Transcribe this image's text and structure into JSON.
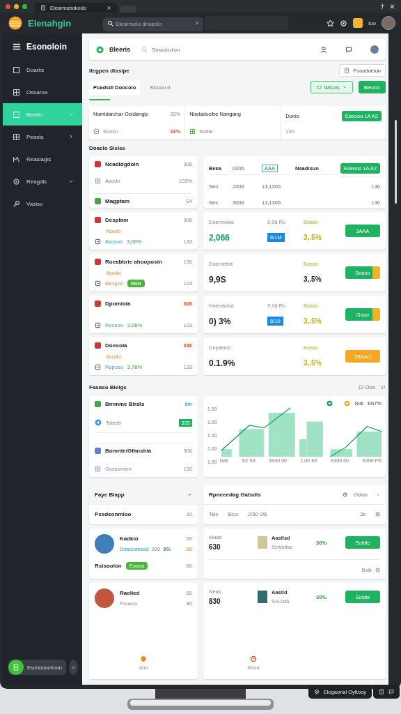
{
  "window": {
    "tab_title": "Elearmsbokodo"
  },
  "topbar": {
    "brand": "Elenahgin",
    "search_placeholder": "Elearmolo dhosolo",
    "user_label": "Ioo"
  },
  "sidebar": {
    "title": "Esonoloin",
    "items": [
      {
        "label": "Doarks",
        "selected": false,
        "has_children": false
      },
      {
        "label": "Ossaroa",
        "selected": false,
        "has_children": false
      },
      {
        "label": "Beario",
        "selected": true,
        "has_children": true,
        "expanded": true
      },
      {
        "label": "Peasia",
        "selected": false,
        "has_children": true,
        "expanded": false
      },
      {
        "label": "Reaslagis",
        "selected": false,
        "has_children": false
      },
      {
        "label": "Reagdis",
        "selected": false,
        "has_children": true,
        "expanded": true
      },
      {
        "label": "Vasiso",
        "selected": false,
        "has_children": false
      }
    ],
    "footer_button": "Esonoouchoon"
  },
  "header_card": {
    "title": "Bleeris",
    "search_placeholder": "Smodoolon"
  },
  "page": {
    "title": "Ilegpen dissipe",
    "action": "Fooodoeion"
  },
  "tabs": [
    {
      "label": "Poadsdi Doocolo",
      "selected": true
    },
    {
      "label": "Slcoou 0",
      "selected": false
    }
  ],
  "toolbar_buttons": [
    {
      "label": "Wisois",
      "kind": "outline"
    },
    {
      "label": "Bleooo",
      "kind": "solid"
    }
  ],
  "summary": {
    "columns": [
      {
        "title": "Namidarchar Ooidangip",
        "value": "33%",
        "sub": "Sooso",
        "sub_value": "33%"
      },
      {
        "title": "Nisdadocibe Nangang",
        "sub": "Sobie"
      },
      {
        "title": "Donio",
        "sub": "190"
      }
    ],
    "button": "Eseooo 1A A2"
  },
  "section1": {
    "title": "Doaclo Sielee"
  },
  "left_cards": [
    {
      "rows": [
        {
          "kind": "title",
          "text": "Ncadidgdoin",
          "value": "306",
          "alert": false
        },
        {
          "kind": "plain",
          "text": "Asodo",
          "value": "103%"
        },
        {
          "kind": "title",
          "text": "Magptam",
          "value": "04",
          "alert": false
        }
      ]
    },
    {
      "rows": [
        {
          "kind": "title",
          "text": "Desplam",
          "value": "306",
          "alert": false
        },
        {
          "kind": "note",
          "text": "Asodo"
        },
        {
          "kind": "stat",
          "text": "Asosoo",
          "pct": "3,06%",
          "value": "133"
        }
      ]
    },
    {
      "rows": [
        {
          "kind": "title",
          "text": "Roeabbrie ahooposin",
          "value": "106",
          "alert": false
        },
        {
          "kind": "note",
          "text": "Asodo"
        },
        {
          "kind": "tagged",
          "text": "Beogoe",
          "tag": "BBB",
          "value": "103"
        }
      ]
    },
    {
      "rows": [
        {
          "kind": "title",
          "text": "Dpomiola",
          "value": "306",
          "alert": true
        },
        {
          "kind": "stat",
          "text": "Roosoo",
          "pct": "3,06%",
          "value": "103"
        }
      ]
    },
    {
      "rows": [
        {
          "kind": "title",
          "text": "Doeoola",
          "value": "336",
          "alert": true
        },
        {
          "kind": "note",
          "text": "Asodo"
        },
        {
          "kind": "stat",
          "text": "Roposo",
          "pct": "3,76%",
          "value": "133"
        }
      ]
    }
  ],
  "right_cards": [
    {
      "kind": "table",
      "header": [
        "Besa",
        "0006",
        "AAA",
        "Nsadisun"
      ],
      "button": "Eseooo 1A A2",
      "rows": [
        [
          "Seo",
          "2006",
          "13,1306",
          "130"
        ],
        [
          "Ses",
          "3006",
          "13,1306",
          "130"
        ]
      ]
    },
    {
      "kind": "metric",
      "label": "Doennolee",
      "value": "2,066",
      "value_positive": true,
      "mid": "8,98 Ro",
      "badge": "8/1M",
      "change_label": "Bosso",
      "change": "3,.5%",
      "change_highlight": true,
      "button": "3AAA",
      "button_warning": false,
      "button_accent": false
    },
    {
      "kind": "metric",
      "label": "Doeroeilot",
      "value": "9,9S",
      "value_positive": false,
      "change_label": "Bosso",
      "change": "3,.5%",
      "change_highlight": false,
      "button": "Bosso",
      "button_warning": false,
      "button_accent": true
    },
    {
      "kind": "metric",
      "label": "Hoendeilot",
      "value": "0) 3%",
      "value_positive": false,
      "mid": "9,96 Ro",
      "badge": "8/10",
      "change_label": "Bosso",
      "change": "3,.5%",
      "change_highlight": true,
      "button": "Gooo",
      "button_warning": false,
      "button_accent": true
    },
    {
      "kind": "metric",
      "label": "Depalnist",
      "value": "0.1.9%",
      "value_positive": false,
      "change_label": "Bosso",
      "change": "3,.5%",
      "change_highlight": true,
      "button": "33AAO",
      "button_warning": true,
      "button_accent": false
    }
  ],
  "section2": {
    "title": "Fasaso Bielgs",
    "action": "Ooo"
  },
  "list_card": {
    "rows": [
      {
        "kind": "title",
        "text": "Bmmme Blrdis",
        "value": "8m"
      },
      {
        "kind": "badge",
        "text": "Taleeb",
        "value": "333"
      },
      {
        "kind": "title",
        "text": "Bomnte/Gfanshia",
        "value": "306"
      },
      {
        "kind": "plain",
        "text": "Gossomien",
        "value": "100"
      }
    ]
  },
  "chart_panel": {
    "y_labels": [
      "1.00",
      "1.00",
      "1.00",
      "1.00",
      "1.00"
    ],
    "x_labels": [
      "Nas",
      "S3 S3",
      "3S00 00",
      "1.00 S0",
      "S300 00",
      "S300 PS"
    ],
    "legend": [
      "Sldi",
      "Eb7%"
    ]
  },
  "people_panel": {
    "title": "Faye Biapp",
    "subtitle": "Pssdsonmioo",
    "subtitle_value": "10",
    "people": [
      {
        "name": "Kadkio",
        "detail": "Dossoanesd",
        "amount": "300",
        "change": "3%",
        "value1": "00",
        "value2": "80",
        "tag_label": "Rsisoolon",
        "tag": "Eoooo",
        "tag_value": "80"
      },
      {
        "name": "Raelied",
        "detail": "Poosoo",
        "value1": "80",
        "value2": "80"
      }
    ],
    "footer": "ano"
  },
  "report_panel": {
    "title": "Rpneeedag Gatsdis",
    "action": "Ooloo",
    "columns": [
      "Tsio",
      "Bioo",
      "2/30 0/6"
    ],
    "header_value": "3s",
    "items": [
      {
        "label": "Maas",
        "value": "630",
        "name": "Aaslisd",
        "detail": "Sclsbdss",
        "pct": "30%",
        "button": "Soldte",
        "note": "Bsib"
      },
      {
        "label": "Neas",
        "value": "830",
        "name": "Aaslid",
        "detail": "Sol.0d6",
        "pct": "30%",
        "button": "Soldie"
      }
    ],
    "footer": "8ood"
  },
  "float_bar": {
    "label": "Elogaonal Oyttooy"
  }
}
